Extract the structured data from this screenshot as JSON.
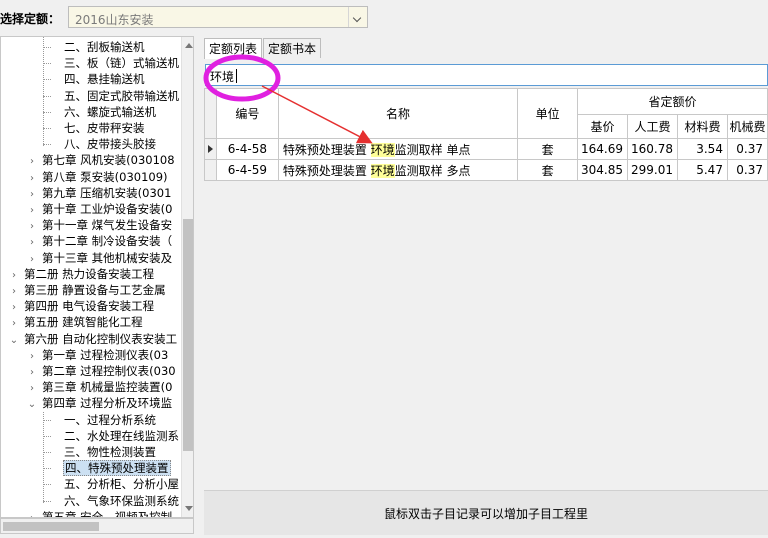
{
  "header": {
    "select_label": "选择定额：",
    "quota_value": "2016山东安装"
  },
  "tree": {
    "items": [
      {
        "label": "二、刮板输送机",
        "expander": "",
        "selected": false
      },
      {
        "label": "三、板（链）式输送机",
        "expander": "",
        "selected": false
      },
      {
        "label": "四、悬挂输送机",
        "expander": "",
        "selected": false
      },
      {
        "label": "五、固定式胶带输送机",
        "expander": "",
        "selected": false
      },
      {
        "label": "六、螺旋式输送机",
        "expander": "",
        "selected": false
      },
      {
        "label": "七、皮带秤安装",
        "expander": "",
        "selected": false
      },
      {
        "label": "八、皮带接头胶接",
        "expander": "",
        "selected": false
      },
      {
        "label": "第七章 风机安装(030108",
        "expander": "›",
        "selected": false
      },
      {
        "label": "第八章 泵安装(030109)",
        "expander": "›",
        "selected": false
      },
      {
        "label": "第九章 压缩机安装(0301",
        "expander": "›",
        "selected": false
      },
      {
        "label": "第十章 工业炉设备安装(0",
        "expander": "›",
        "selected": false
      },
      {
        "label": "第十一章 煤气发生设备安",
        "expander": "›",
        "selected": false
      },
      {
        "label": "第十二章 制冷设备安装（",
        "expander": "›",
        "selected": false
      },
      {
        "label": "第十三章 其他机械安装及",
        "expander": "›",
        "selected": false
      },
      {
        "label": "第二册 热力设备安装工程",
        "expander": "›",
        "selected": false
      },
      {
        "label": "第三册 静置设备与工艺金属",
        "expander": "›",
        "selected": false
      },
      {
        "label": "第四册 电气设备安装工程",
        "expander": "›",
        "selected": false
      },
      {
        "label": "第五册 建筑智能化工程",
        "expander": "›",
        "selected": false
      },
      {
        "label": "第六册 自动化控制仪表安装工",
        "expander": "⌄",
        "selected": false
      },
      {
        "label": "第一章 过程检测仪表(03",
        "expander": "›",
        "selected": false
      },
      {
        "label": "第二章 过程控制仪表(030",
        "expander": "›",
        "selected": false
      },
      {
        "label": "第三章 机械量监控装置(0",
        "expander": "›",
        "selected": false
      },
      {
        "label": "第四章 过程分析及环境监",
        "expander": "⌄",
        "selected": false
      },
      {
        "label": "一、过程分析系统",
        "expander": "",
        "selected": false
      },
      {
        "label": "二、水处理在线监测系",
        "expander": "",
        "selected": false
      },
      {
        "label": "三、物性检测装置",
        "expander": "",
        "selected": false
      },
      {
        "label": "四、特殊预处理装置",
        "expander": "",
        "selected": true
      },
      {
        "label": "五、分析柜、分析小屋",
        "expander": "",
        "selected": false
      },
      {
        "label": "六、气象环保监测系统",
        "expander": "",
        "selected": false
      },
      {
        "label": "第五章 安全、视频及控制",
        "expander": "›",
        "selected": false
      }
    ]
  },
  "tabs": [
    {
      "label": "定额列表"
    },
    {
      "label": "定额书本"
    }
  ],
  "search": {
    "value": "环境"
  },
  "table": {
    "headers": {
      "code": "编号",
      "name": "名称",
      "unit": "单位",
      "group": "省定额价",
      "base": "基价",
      "labor": "人工费",
      "material": "材料费",
      "machine": "机械费"
    },
    "rows": [
      {
        "code": "6-4-58",
        "name_pre": "特殊预处理装置 ",
        "name_hl": "环境",
        "name_post": "监测取样 单点",
        "unit": "套",
        "base": "164.69",
        "labor": "160.78",
        "material": "3.54",
        "machine": "0.37"
      },
      {
        "code": "6-4-59",
        "name_pre": "特殊预处理装置 ",
        "name_hl": "环境",
        "name_post": "监测取样 多点",
        "unit": "套",
        "base": "304.85",
        "labor": "299.01",
        "material": "5.47",
        "machine": "0.37"
      }
    ]
  },
  "status": {
    "message": "鼠标双击子目记录可以增加子目工程里"
  },
  "colors": {
    "annotation": "#e020e0",
    "arrow": "#e53030",
    "highlight": "#ffff99"
  }
}
